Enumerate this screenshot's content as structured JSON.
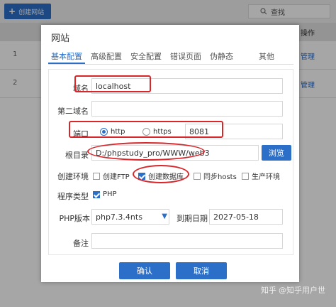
{
  "background": {
    "create_button": "创建网站",
    "search_placeholder": "查找",
    "header_operation": "操作",
    "rows": [
      {
        "num": "1",
        "manage": "管理"
      },
      {
        "num": "2",
        "manage": "管理"
      }
    ]
  },
  "dialog": {
    "title": "网站",
    "tabs": [
      "基本配置",
      "高级配置",
      "安全配置",
      "错误页面",
      "伪静态",
      "其他"
    ],
    "domain_label": "域名",
    "domain_value": "localhost",
    "second_domain_label": "第二域名",
    "second_domain_value": "",
    "port_label": "端口",
    "protocol_http": "http",
    "protocol_https": "https",
    "port_value": "8081",
    "root_label": "根目录",
    "root_value": "D:/phpstudy_pro/WWW/web3",
    "browse_label": "浏览",
    "env_label": "创建环境",
    "env_options": [
      "创建FTP",
      "创建数据库",
      "同步hosts",
      "生产环境"
    ],
    "type_label": "程序类型",
    "type_option": "PHP",
    "php_version_label": "PHP版本",
    "php_version_value": "php7.3.4nts",
    "expire_label": "到期日期",
    "expire_value": "2027-05-18",
    "notes_label": "备注",
    "notes_value": "",
    "confirm_label": "确认",
    "cancel_label": "取消"
  },
  "watermark": {
    "brand": "知乎",
    "user": "@知乎用户世"
  },
  "colors": {
    "accent": "#2b6fc9",
    "annotation": "#d8262a"
  }
}
